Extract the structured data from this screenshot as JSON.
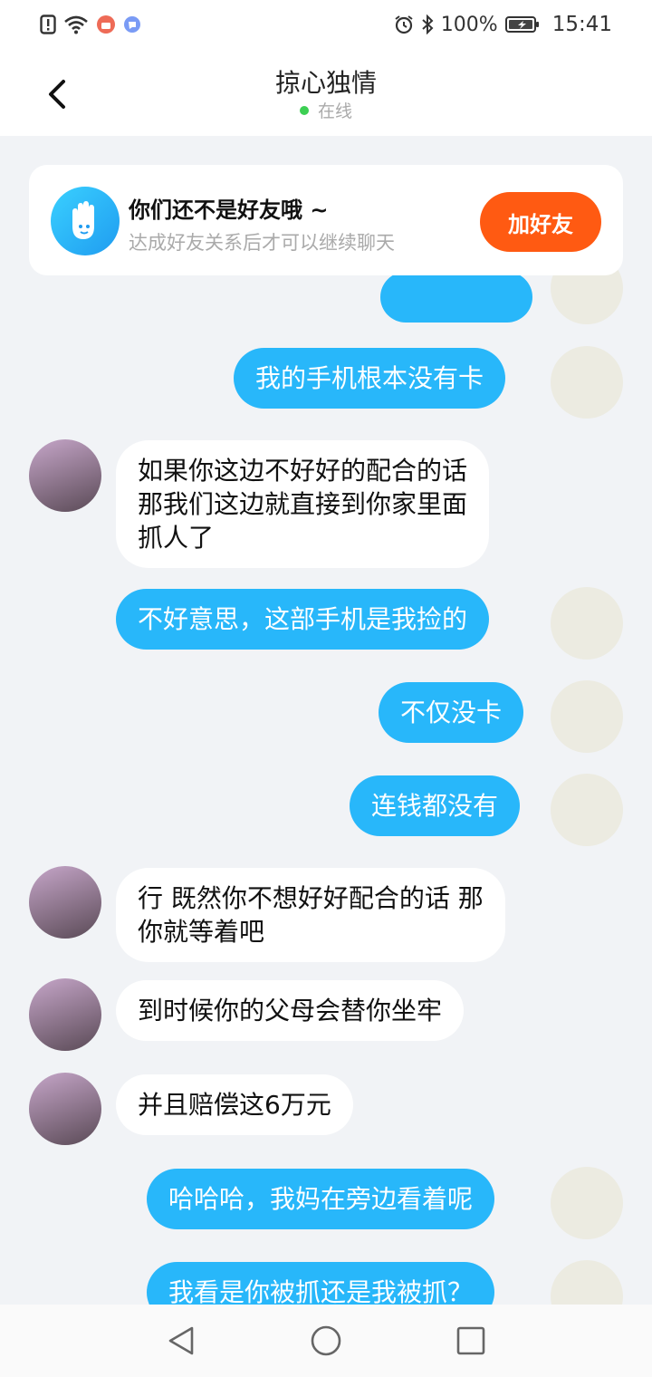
{
  "status_bar": {
    "battery": "100%",
    "time": "15:41",
    "left_icons": [
      "sim-alert-icon",
      "wifi-icon",
      "app-notification-icon",
      "app-notification-icon-2"
    ],
    "right_icons": [
      "alarm-icon",
      "bluetooth-icon",
      "battery-icon"
    ]
  },
  "header": {
    "title": "掠心独情",
    "status": "在线",
    "status_color": "#3ccf53"
  },
  "banner": {
    "title": "你们还不是好友哦 ~",
    "subtitle": "达成好友关系后才可以继续聊天",
    "button": "加好友",
    "button_color": "#ff5a12"
  },
  "messages": [
    {
      "from": "me",
      "text": "我的手机根本没有卡"
    },
    {
      "from": "other",
      "text": "如果你这边不好好的配合的话\n那我们这边就直接到你家里面\n抓人了"
    },
    {
      "from": "me",
      "text": "不好意思，这部手机是我捡的"
    },
    {
      "from": "me",
      "text": "不仅没卡"
    },
    {
      "from": "me",
      "text": "连钱都没有"
    },
    {
      "from": "other",
      "text": "行 既然你不想好好配合的话 那\n你就等着吧"
    },
    {
      "from": "other",
      "text": "到时候你的父母会替你坐牢"
    },
    {
      "from": "other",
      "text": "并且赔偿这6万元"
    },
    {
      "from": "me",
      "text": "哈哈哈，我妈在旁边看着呢"
    },
    {
      "from": "me",
      "text": "我看是你被抓还是我被抓？"
    }
  ],
  "colors": {
    "sent_bubble": "#28b7fa",
    "received_bubble": "#ffffff",
    "chat_background": "#f1f3f6"
  },
  "nav": [
    "back-nav-icon",
    "home-nav-icon",
    "recents-nav-icon"
  ]
}
